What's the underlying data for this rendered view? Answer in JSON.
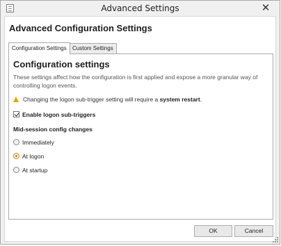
{
  "window": {
    "title": "Advanced Settings",
    "close_glyph": "✕"
  },
  "dialog": {
    "heading": "Advanced Configuration Settings"
  },
  "tabs": [
    {
      "label": "Configuration Settings",
      "active": true
    },
    {
      "label": "Custom Settings",
      "active": false
    }
  ],
  "panel": {
    "section_title": "Configuration settings",
    "description": "These settings affect how the configuration is first applied and expose a more granular way of controlling logon events.",
    "warning": {
      "text_before": "Changing the logon sub-trigger setting will require a ",
      "emphasis": "system restart",
      "text_after": ".",
      "icon": "warning-icon",
      "icon_color": "#e5a500"
    },
    "checkbox": {
      "label": "Enable logon sub-triggers",
      "checked": true
    },
    "group_label": "Mid-session config changes",
    "radios": [
      {
        "label": "Immediately",
        "selected": false
      },
      {
        "label": "At logon",
        "selected": true
      },
      {
        "label": "At startup",
        "selected": false
      }
    ]
  },
  "buttons": {
    "ok": "OK",
    "cancel": "Cancel"
  },
  "colors": {
    "radio_selected": "#c48a12",
    "window_bg": "#f0f0f0"
  }
}
